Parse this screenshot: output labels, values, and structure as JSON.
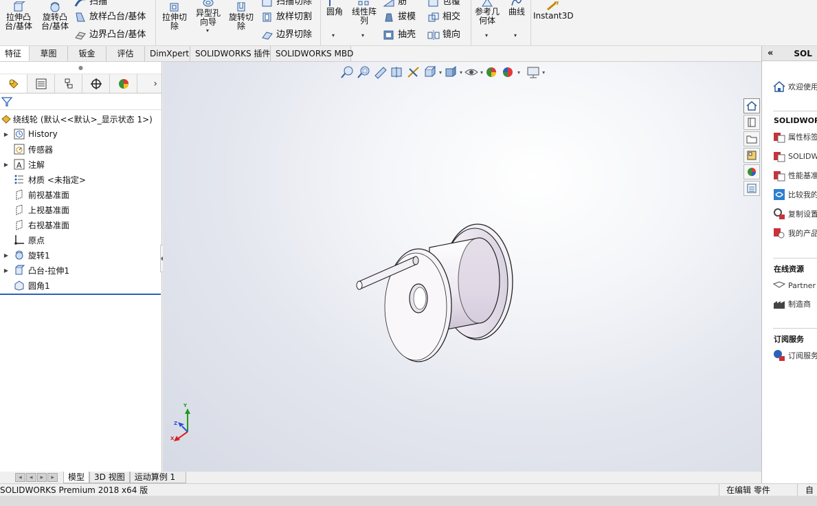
{
  "ribbon": {
    "extrude_boss": "拉伸凸台/基体",
    "revolve_boss": "旋转凸台/基体",
    "sweep": "扫描",
    "loft_boss": "放样凸台/基体",
    "boundary_boss": "边界凸台/基体",
    "extrude_cut": "拉伸切除",
    "hole_wizard": "异型孔向导",
    "revolve_cut": "旋转切除",
    "swept_cut": "扫描切除",
    "loft_cut": "放样切割",
    "boundary_cut": "边界切除",
    "fillet": "圆角",
    "linear_pattern": "线性阵列",
    "rib": "筋",
    "draft": "拔模",
    "shell": "抽壳",
    "wrap": "包覆",
    "intersect": "相交",
    "mirror": "镜向",
    "ref_geometry": "参考几何体",
    "curves": "曲线",
    "instant3d": "Instant3D"
  },
  "tabs": [
    "特征",
    "草图",
    "钣金",
    "评估",
    "DimXpert",
    "SOLIDWORKS 插件",
    "SOLIDWORKS MBD"
  ],
  "tree": {
    "root": "绕线轮 (默认<<默认>_显示状态 1>)",
    "items": [
      "History",
      "传感器",
      "注解",
      "材质 <未指定>",
      "前视基准面",
      "上视基准面",
      "右视基准面",
      "原点",
      "旋转1",
      "凸台-拉伸1",
      "圆角1"
    ]
  },
  "triad": {
    "y": "Y",
    "z": "Z",
    "x": "X"
  },
  "bottom_tabs": [
    "模型",
    "3D 视图",
    "运动算例 1"
  ],
  "status": {
    "product": "SOLIDWORKS Premium 2018 x64 版",
    "editing": "在编辑 零件",
    "custom": "自定"
  },
  "taskpane": {
    "title": "SOL",
    "welcome": "欢迎使用",
    "sec_solidworks": "SOLIDWORKS",
    "items": [
      "属性标签",
      "SOLIDW",
      "性能基准",
      "比较我的",
      "复制设置",
      "我的产品"
    ],
    "sec_online": "在线资源",
    "online_items": [
      "Partner",
      "制造商"
    ],
    "sec_subscription": "订阅服务",
    "sub_items": [
      "订阅服务"
    ]
  },
  "colors": {
    "accent": "#2a62b8",
    "part_face": "#f0edf3",
    "part_shade": "#c9c0d2"
  }
}
